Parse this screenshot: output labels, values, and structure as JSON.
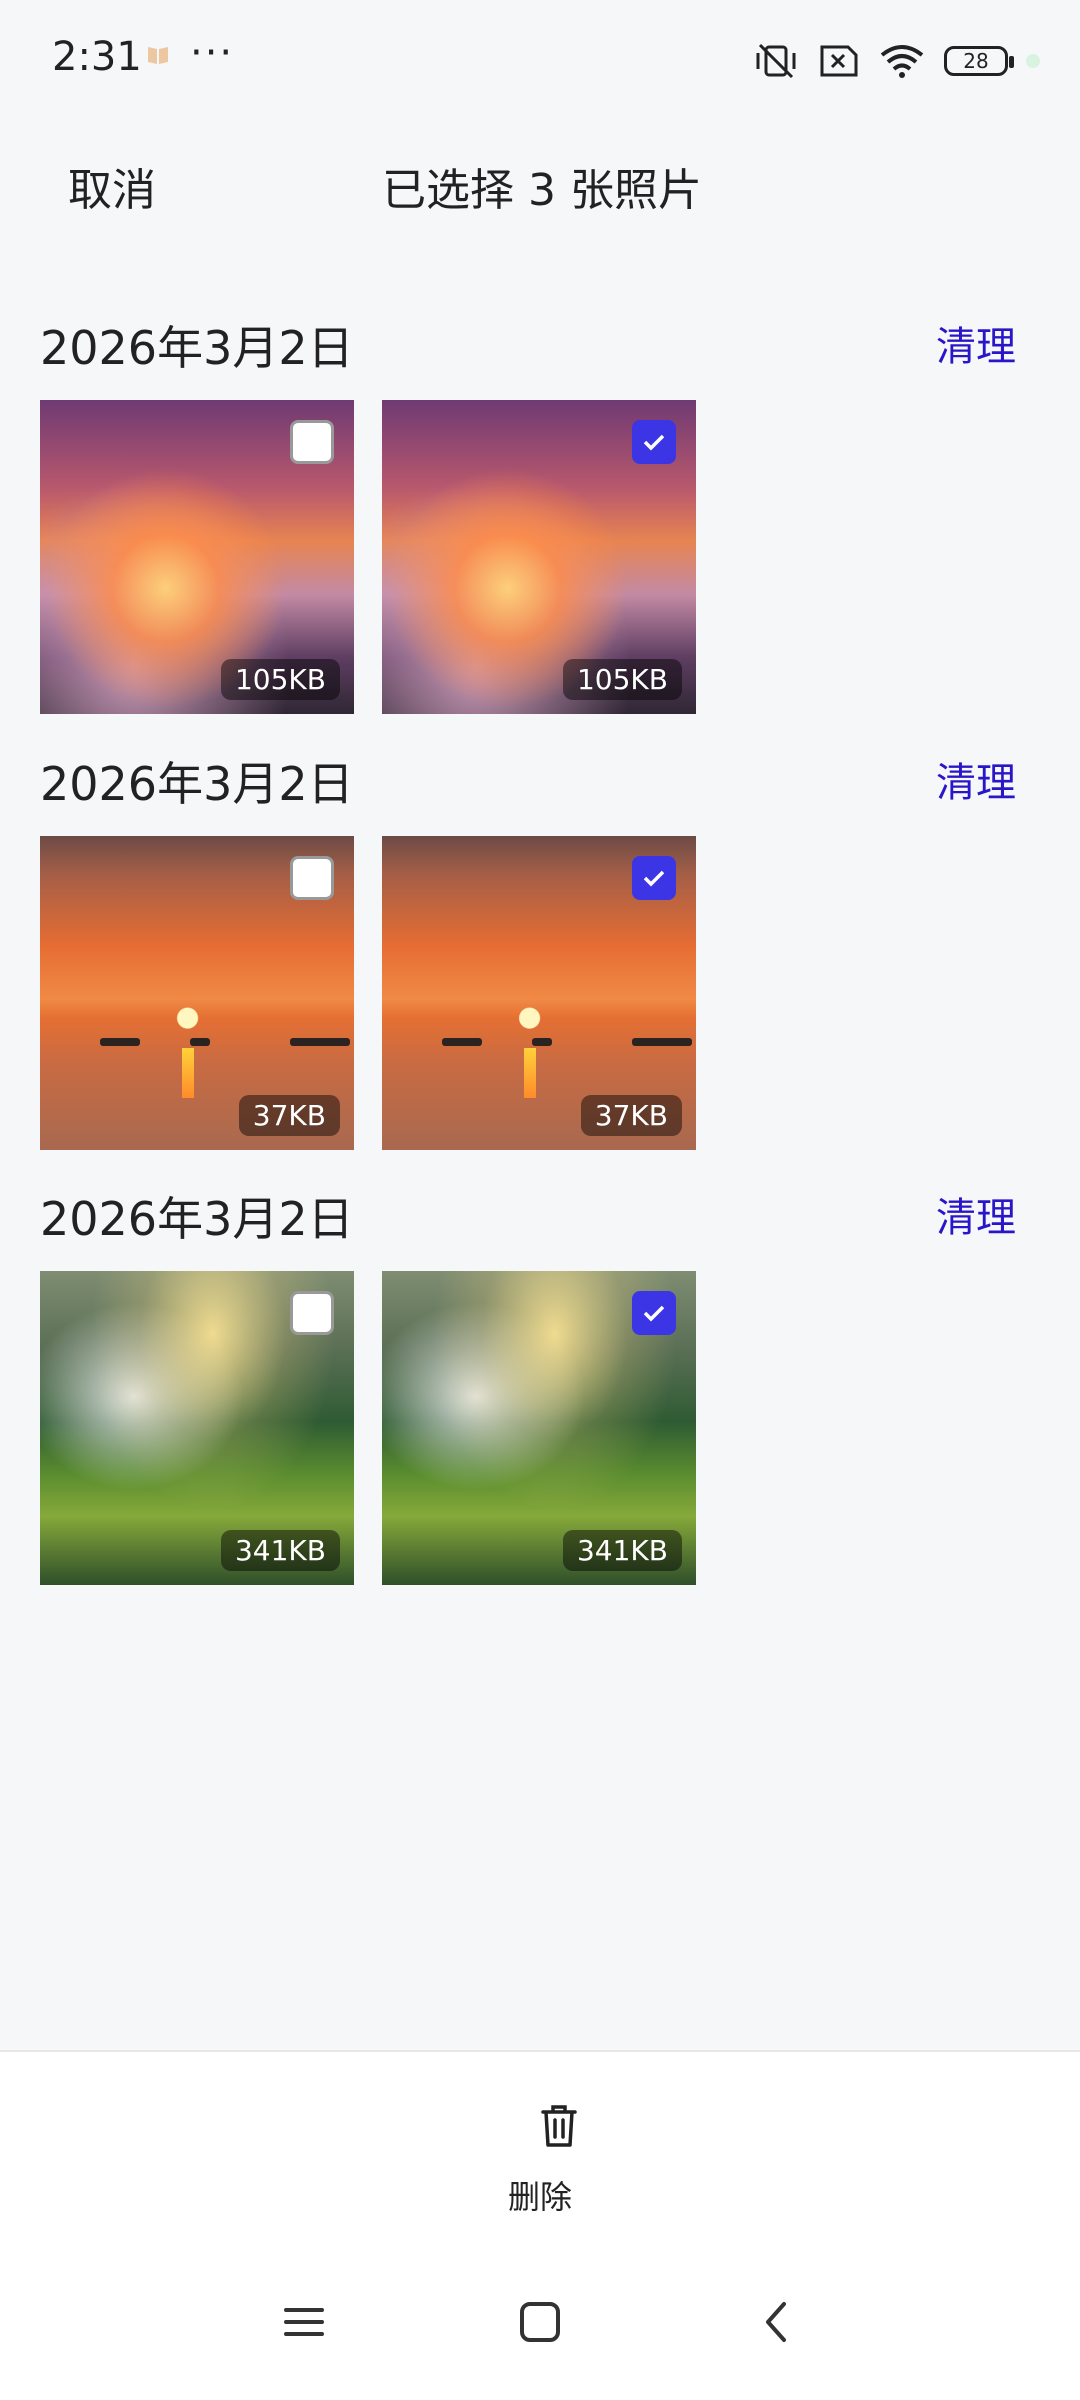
{
  "status_bar": {
    "time": "2:31",
    "more": "···",
    "battery": "28",
    "icons": [
      "book-icon",
      "mute-icon",
      "sim-x-icon",
      "wifi-icon",
      "battery-icon"
    ]
  },
  "header": {
    "cancel": "取消",
    "title": "已选择 3 张照片"
  },
  "groups": [
    {
      "date": "2026年3月2日",
      "action": "清理",
      "photos": [
        {
          "size": "105KB",
          "checked": false,
          "image": "sunset-clouds"
        },
        {
          "size": "105KB",
          "checked": true,
          "image": "sunset-clouds"
        }
      ]
    },
    {
      "date": "2026年3月2日",
      "action": "清理",
      "photos": [
        {
          "size": "37KB",
          "checked": false,
          "image": "sea-sunset"
        },
        {
          "size": "37KB",
          "checked": true,
          "image": "sea-sunset"
        }
      ]
    },
    {
      "date": "2026年3月2日",
      "action": "清理",
      "photos": [
        {
          "size": "341KB",
          "checked": false,
          "image": "valley"
        },
        {
          "size": "341KB",
          "checked": true,
          "image": "valley"
        }
      ]
    }
  ],
  "bottom": {
    "delete": "删除"
  },
  "colors": {
    "accent": "#3b35e6",
    "link": "#2a16c9",
    "background": "#f6f7f9"
  }
}
